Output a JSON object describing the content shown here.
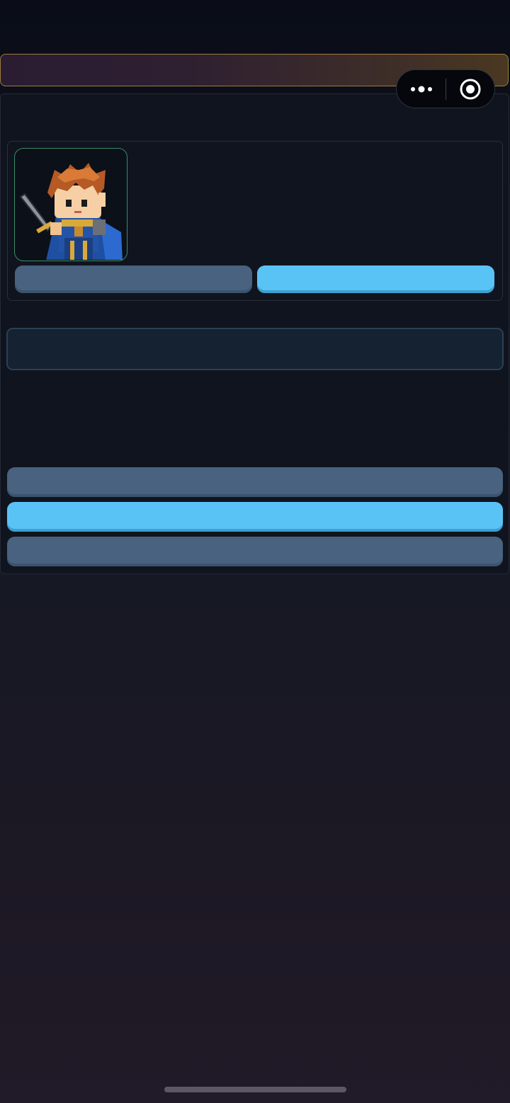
{
  "app": {
    "window_controls": {
      "menu_icon": "more-dots-icon",
      "close_icon": "circle-target-icon"
    }
  },
  "banner": {
    "text": ""
  },
  "hero": {
    "portrait_icon": "pixel-knight-sprite",
    "left_button_label": "",
    "right_button_label": ""
  },
  "input": {
    "value": "",
    "placeholder": ""
  },
  "actions": {
    "button_1_label": "",
    "button_2_label": "",
    "button_3_label": ""
  },
  "colors": {
    "accent_sky": "#5ac3f5",
    "accent_slate": "#48627f",
    "banner_border": "#9c7a3e",
    "portrait_border": "#3c8a68"
  }
}
